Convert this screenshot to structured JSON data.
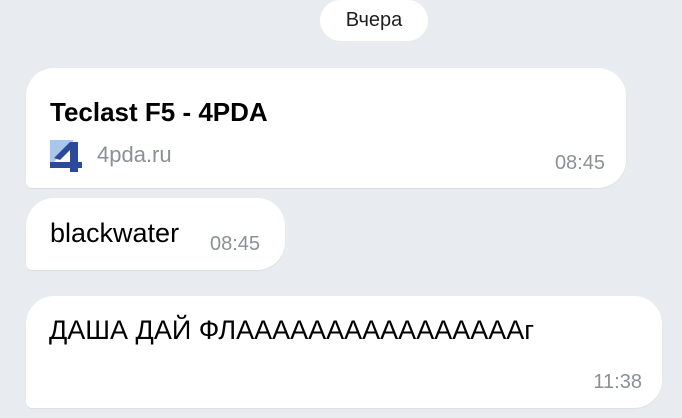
{
  "date_separator": "Вчера",
  "messages": [
    {
      "type": "link",
      "title": "Teclast F5 - 4PDA",
      "domain": "4pda.ru",
      "favicon_icon": "4pda-logo-icon",
      "time": "08:45"
    },
    {
      "type": "text",
      "text": "blackwater",
      "time": "08:45"
    },
    {
      "type": "text",
      "text": "ДАША ДАЙ ФЛААААААААААААААААг",
      "time": "11:38"
    }
  ],
  "colors": {
    "background": "#e8ebf0",
    "bubble": "#ffffff",
    "meta_text": "#8c9096",
    "logo_blue": "#2c4a9c",
    "logo_light": "#a9c6ec"
  }
}
